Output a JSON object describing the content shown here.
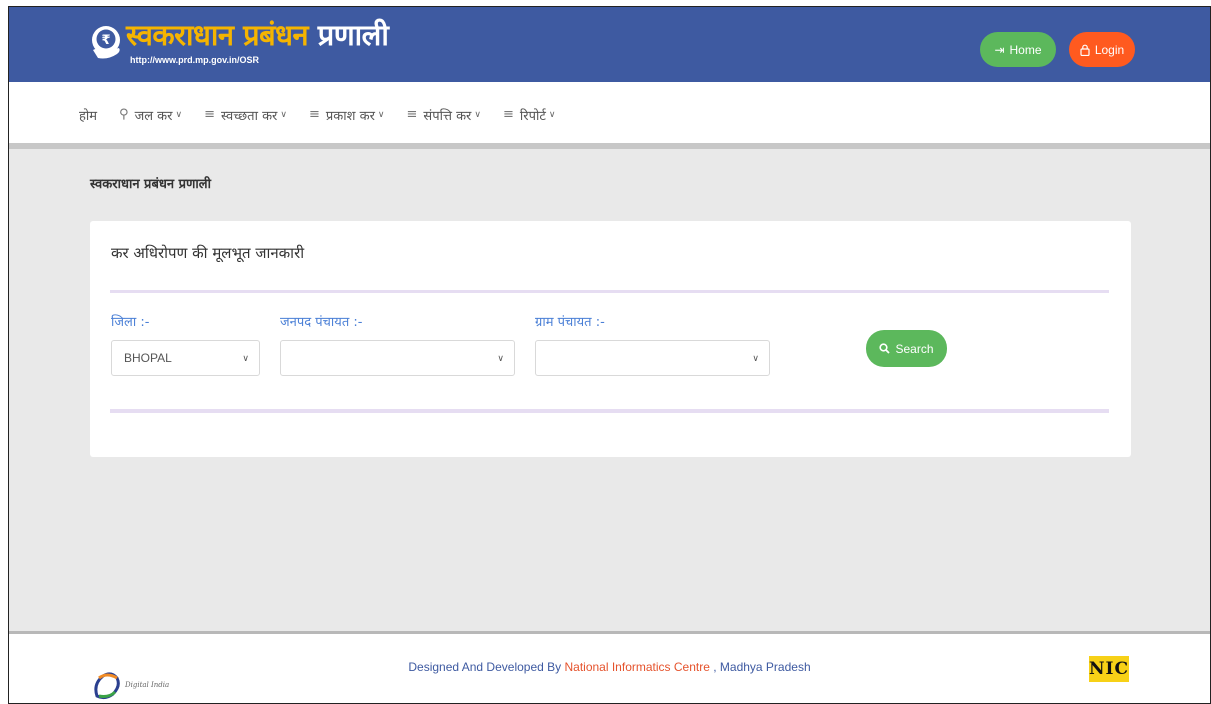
{
  "header": {
    "title_part1": "स्वकराधान प्रबंधन",
    "title_part2": "प्रणाली",
    "url": "http://www.prd.mp.gov.in/OSR",
    "home_label": "Home",
    "login_label": "Login"
  },
  "nav": {
    "items": [
      {
        "label": "होम",
        "icon": "",
        "has_dropdown": false
      },
      {
        "label": "जल कर",
        "icon": "user-icon",
        "has_dropdown": true
      },
      {
        "label": "स्वच्छता कर",
        "icon": "list-icon",
        "has_dropdown": true
      },
      {
        "label": "प्रकाश कर",
        "icon": "list-icon",
        "has_dropdown": true
      },
      {
        "label": "संपत्ति कर",
        "icon": "list-icon",
        "has_dropdown": true
      },
      {
        "label": "रिपोर्ट",
        "icon": "list-icon",
        "has_dropdown": true
      }
    ]
  },
  "page": {
    "heading": "स्वकराधान प्रबंधन प्रणाली"
  },
  "form": {
    "title": "कर अधिरोपण की मूलभूत जानकारी",
    "district_label": "जिला :-",
    "district_value": "BHOPAL",
    "janpad_label": "जनपद पंचायत :-",
    "janpad_value": "",
    "gram_label": "ग्राम पंचायत :-",
    "gram_value": "",
    "search_label": "Search"
  },
  "footer": {
    "text_prefix": "Designed And Developed By ",
    "org": "National Informatics Centre",
    "text_suffix": " , Madhya Pradesh",
    "nic_logo_text": "NIC",
    "digital_india_text": "Digital India"
  },
  "colors": {
    "header_bg": "#3e5aa1",
    "title_gold": "#f5b400",
    "home_green": "#5cb85c",
    "login_orange": "#ff5a1f",
    "label_blue": "#4a7fd6",
    "footer_org": "#e5532d"
  }
}
